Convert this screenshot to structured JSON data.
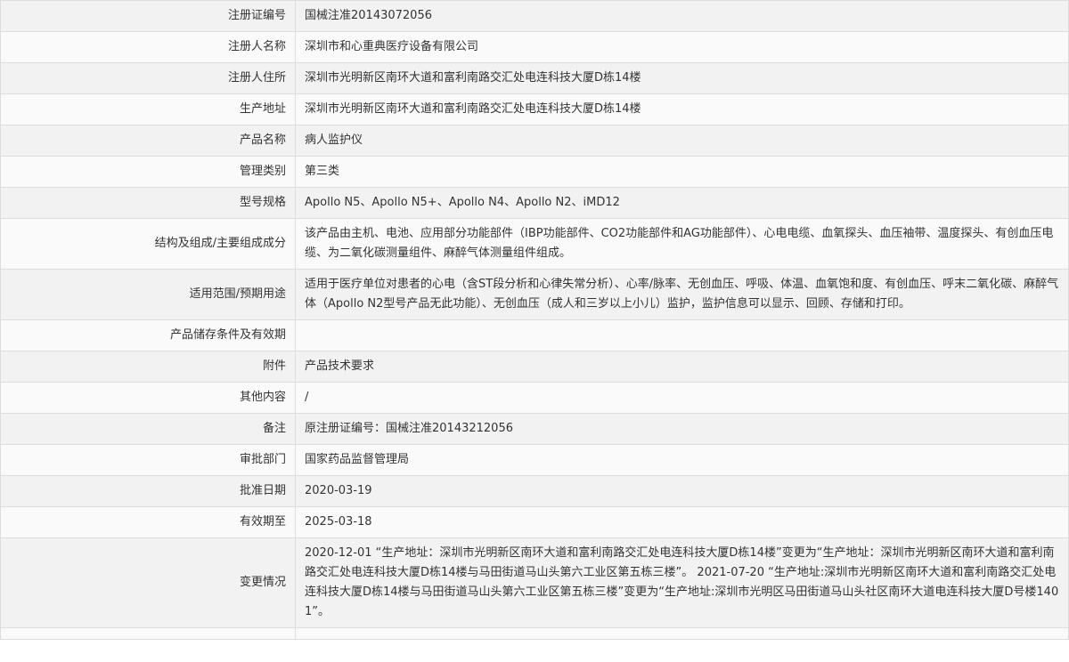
{
  "rows": [
    {
      "label": "注册证编号",
      "value": "国械注准20143072056"
    },
    {
      "label": "注册人名称",
      "value": "深圳市和心重典医疗设备有限公司"
    },
    {
      "label": "注册人住所",
      "value": "深圳市光明新区南环大道和富利南路交汇处电连科技大厦D栋14楼"
    },
    {
      "label": "生产地址",
      "value": "深圳市光明新区南环大道和富利南路交汇处电连科技大厦D栋14楼"
    },
    {
      "label": "产品名称",
      "value": "病人监护仪"
    },
    {
      "label": "管理类别",
      "value": "第三类"
    },
    {
      "label": "型号规格",
      "value": "Apollo N5、Apollo N5+、Apollo N4、Apollo N2、iMD12"
    },
    {
      "label": "结构及组成/主要组成成分",
      "value": "该产品由主机、电池、应用部分功能部件（IBP功能部件、CO2功能部件和AG功能部件）、心电电缆、血氧探头、血压袖带、温度探头、有创血压电缆、为二氧化碳测量组件、麻醉气体测量组件组成。"
    },
    {
      "label": "适用范围/预期用途",
      "value": "适用于医疗单位对患者的心电（含ST段分析和心律失常分析）、心率/脉率、无创血压、呼吸、体温、血氧饱和度、有创血压、呼末二氧化碳、麻醉气体（Apollo N2型号产品无此功能）、无创血压（成人和三岁以上小儿）监护，监护信息可以显示、回顾、存储和打印。"
    },
    {
      "label": "产品储存条件及有效期",
      "value": ""
    },
    {
      "label": "附件",
      "value": "产品技术要求"
    },
    {
      "label": "其他内容",
      "value": "/"
    },
    {
      "label": "备注",
      "value": "原注册证编号：国械注准20143212056"
    },
    {
      "label": "审批部门",
      "value": "国家药品监督管理局"
    },
    {
      "label": "批准日期",
      "value": "2020-03-19"
    },
    {
      "label": "有效期至",
      "value": "2025-03-18"
    },
    {
      "label": "变更情况",
      "value": "2020-12-01 “生产地址：深圳市光明新区南环大道和富利南路交汇处电连科技大厦D栋14楼”变更为“生产地址：深圳市光明新区南环大道和富利南路交汇处电连科技大厦D栋14楼与马田街道马山头第六工业区第五栋三楼”。 2021-07-20 “生产地址:深圳市光明新区南环大道和富利南路交汇处电连科技大厦D栋14楼与马田街道马山头第六工业区第五栋三楼”变更为“生产地址:深圳市光明区马田街道马山头社区南环大道电连科技大厦D号楼1401”。"
    },
    {
      "label": "",
      "value": ""
    }
  ]
}
